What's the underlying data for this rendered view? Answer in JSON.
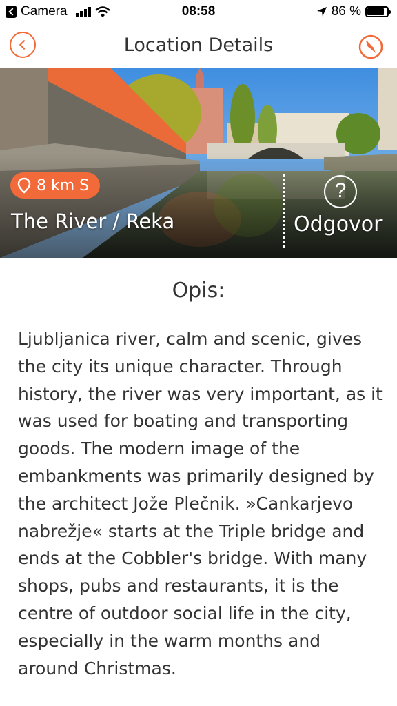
{
  "status_bar": {
    "back_app": "Camera",
    "time": "08:58",
    "battery_percent": "86 %",
    "battery_level": 0.86
  },
  "nav": {
    "title": "Location Details",
    "back_icon": "chevron-left-circle-icon",
    "compass_icon": "compass-icon"
  },
  "hero": {
    "distance": "8 km S",
    "title": "The River / Reka",
    "answer_label": "Odgovor",
    "answer_icon": "?"
  },
  "description": {
    "heading": "Opis:",
    "body": "Ljubljanica river, calm and scenic, gives the city its unique character. Through history, the river was very important, as it was used for boating and transporting goods. The modern image of the embankments was primarily designed by the architect Jože Plečnik. »Cankarjevo nabrežje« starts at the Triple bridge and ends at the Cobbler's bridge. With many shops, pubs and restaurants, it is the centre of outdoor social life in the city, especially in the warm months and around Christmas."
  },
  "colors": {
    "accent": "#f26a3a",
    "text": "#333333"
  }
}
